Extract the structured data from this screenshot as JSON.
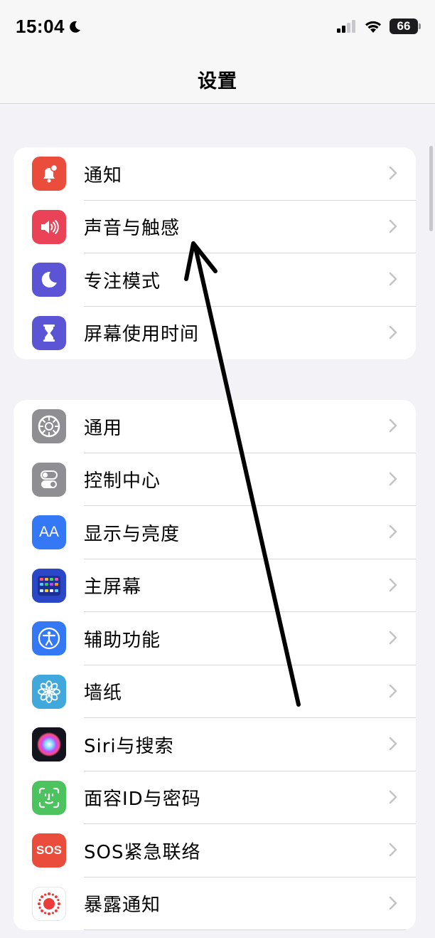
{
  "status_bar": {
    "time": "15:04",
    "battery": "66"
  },
  "nav": {
    "title": "设置"
  },
  "groups": [
    {
      "items": [
        {
          "label": "通知",
          "icon": "notifications-icon",
          "color": "#eb4d3d"
        },
        {
          "label": "声音与触感",
          "icon": "sounds-icon",
          "color": "#ea4257"
        },
        {
          "label": "专注模式",
          "icon": "focus-moon-icon",
          "color": "#5b55d6"
        },
        {
          "label": "屏幕使用时间",
          "icon": "screen-time-hourglass-icon",
          "color": "#5b55d6"
        }
      ]
    },
    {
      "items": [
        {
          "label": "通用",
          "icon": "general-gear-icon",
          "color": "#8e8e93"
        },
        {
          "label": "控制中心",
          "icon": "control-center-icon",
          "color": "#8e8e93"
        },
        {
          "label": "显示与亮度",
          "icon": "display-brightness-icon",
          "color": "#3478f6",
          "icon_text": "AA"
        },
        {
          "label": "主屏幕",
          "icon": "home-screen-icon",
          "color": "#2a47c8"
        },
        {
          "label": "辅助功能",
          "icon": "accessibility-icon",
          "color": "#3478f6"
        },
        {
          "label": "墙纸",
          "icon": "wallpaper-flower-icon",
          "color": "#41a8dc"
        },
        {
          "label": "Siri与搜索",
          "icon": "siri-icon",
          "color": "#1c1c2e"
        },
        {
          "label": "面容ID与密码",
          "icon": "face-id-icon",
          "color": "#4cc35e"
        },
        {
          "label": "SOS紧急联络",
          "icon": "sos-icon",
          "color": "#eb4d3d",
          "icon_text": "SOS"
        },
        {
          "label": "暴露通知",
          "icon": "exposure-notifications-icon",
          "color": "#ffffff"
        }
      ]
    }
  ]
}
